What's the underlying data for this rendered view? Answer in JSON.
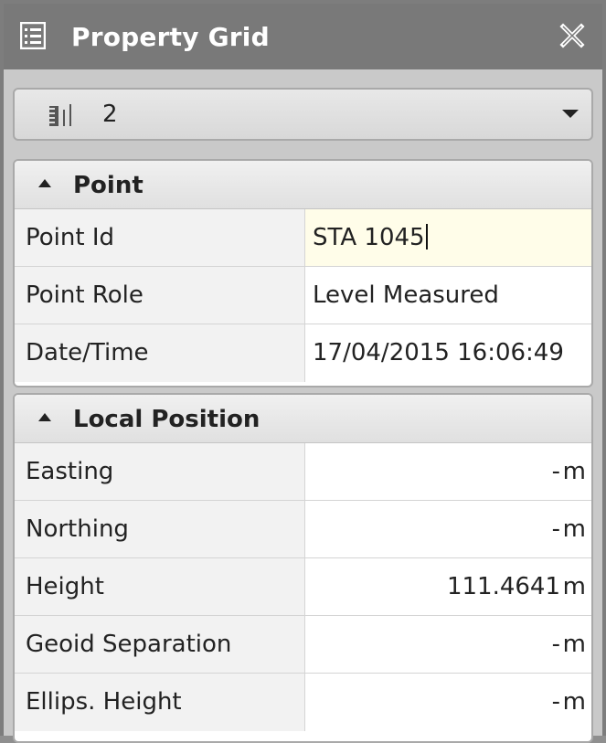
{
  "panel": {
    "title": "Property Grid",
    "title_icon": "list-window-icon",
    "close_icon": "close-icon"
  },
  "selector": {
    "icon": "level-staff-icon",
    "value": "2"
  },
  "sections": {
    "point": {
      "title": "Point",
      "rows": [
        {
          "label": "Point Id",
          "value": "STA 1045"
        },
        {
          "label": "Point Role",
          "value": "Level Measured"
        },
        {
          "label": "Date/Time",
          "value": "17/04/2015 16:06:49"
        }
      ]
    },
    "local_position": {
      "title": "Local Position",
      "rows": [
        {
          "label": "Easting",
          "value": "-",
          "unit": "m"
        },
        {
          "label": "Northing",
          "value": "-",
          "unit": "m"
        },
        {
          "label": "Height",
          "value": "111.4641",
          "unit": "m"
        },
        {
          "label": "Geoid Separation",
          "value": "-",
          "unit": "m"
        },
        {
          "label": "Ellips. Height",
          "value": "-",
          "unit": "m"
        }
      ]
    }
  },
  "colors": {
    "titlebar": "#797979",
    "edit_field": "#fffde9"
  }
}
